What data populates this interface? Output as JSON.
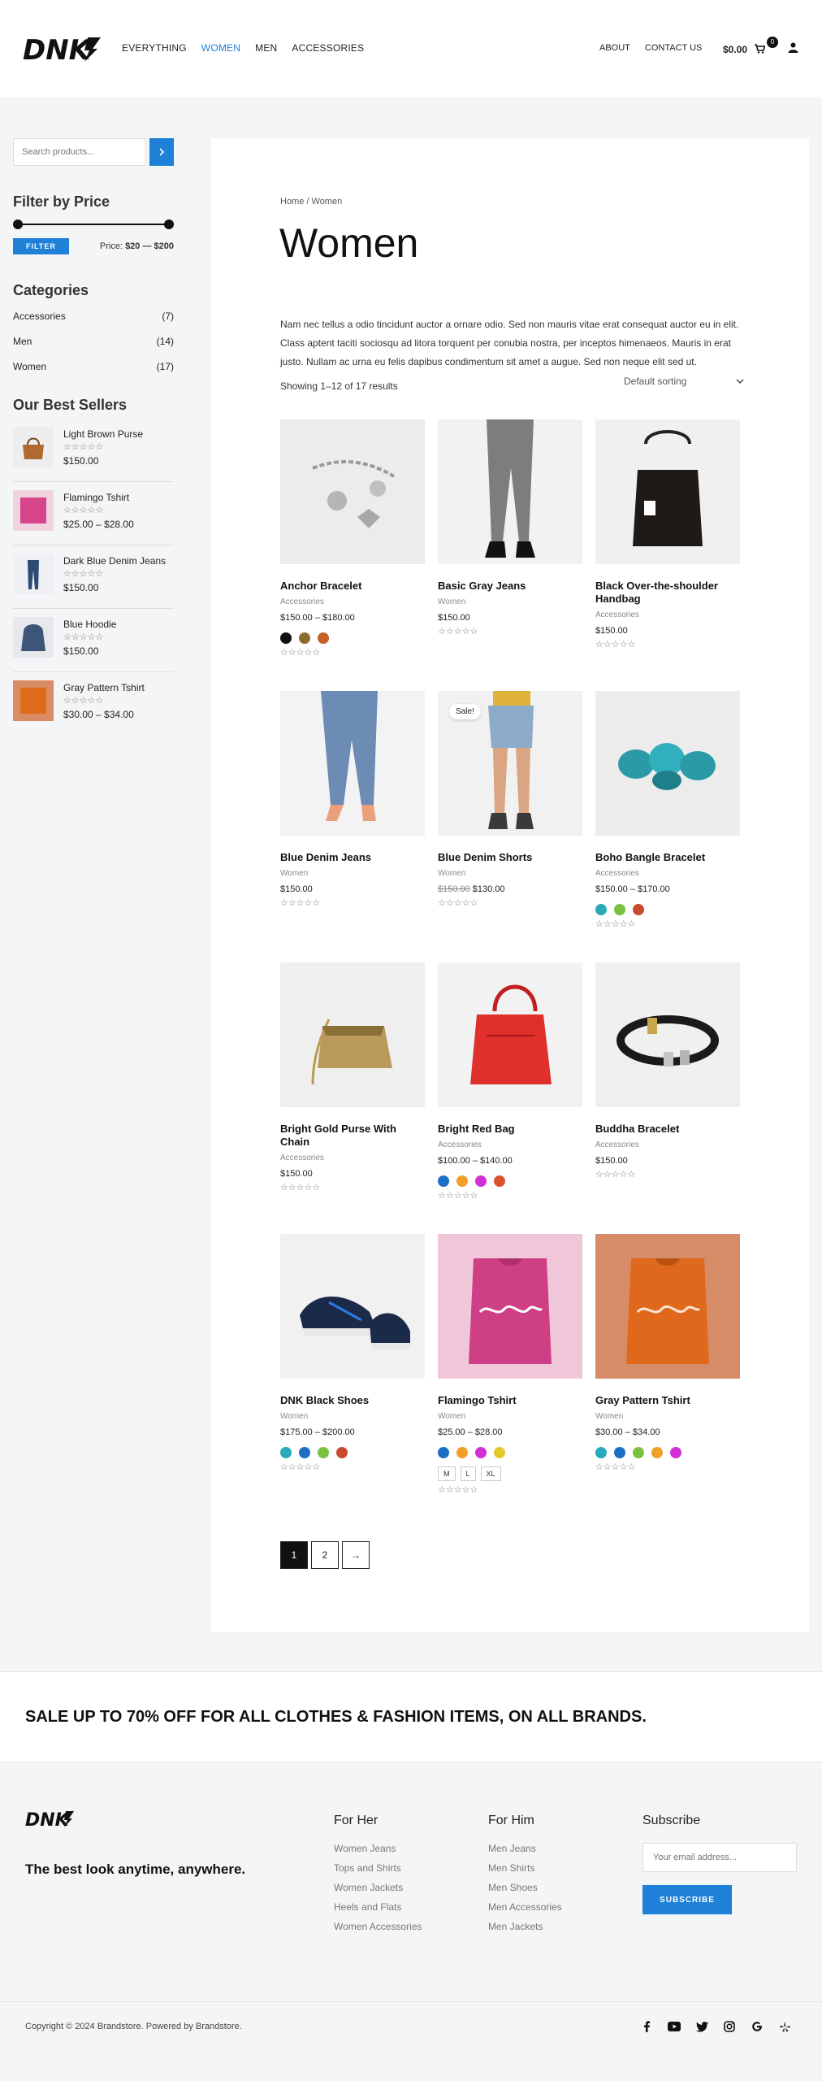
{
  "header": {
    "logo": "DNK",
    "nav": [
      "EVERYTHING",
      "WOMEN",
      "MEN",
      "ACCESSORIES"
    ],
    "nav_active": "WOMEN",
    "nav_right": [
      "ABOUT",
      "CONTACT US"
    ],
    "cart_total": "$0.00",
    "cart_count": "0"
  },
  "sidebar": {
    "search_placeholder": "Search products...",
    "filter_title": "Filter by Price",
    "filter_button": "FILTER",
    "price_prefix": "Price:",
    "price_range": "$20 — $200",
    "categories_title": "Categories",
    "categories": [
      {
        "name": "Accessories",
        "count": "(7)"
      },
      {
        "name": "Men",
        "count": "(14)"
      },
      {
        "name": "Women",
        "count": "(17)"
      }
    ],
    "best_title": "Our Best Sellers",
    "best_sellers": [
      {
        "name": "Light Brown Purse",
        "price": "$150.00"
      },
      {
        "name": "Flamingo Tshirt",
        "price": "$25.00 – $28.00"
      },
      {
        "name": "Dark Blue Denim Jeans",
        "price": "$150.00"
      },
      {
        "name": "Blue Hoodie",
        "price": "$150.00"
      },
      {
        "name": "Gray Pattern Tshirt",
        "price": "$30.00 – $34.00"
      }
    ]
  },
  "main": {
    "breadcrumb": "Home / Women",
    "title": "Women",
    "description": "Nam nec tellus a odio tincidunt auctor a ornare odio. Sed non mauris vitae erat consequat auctor eu in elit. Class aptent taciti sociosqu ad litora torquent per conubia nostra, per inceptos himenaeos. Mauris in erat justo. Nullam ac urna eu felis dapibus condimentum sit amet a augue. Sed non neque elit sed ut.",
    "results": "Showing 1–12 of 17 results",
    "sorting": "Default sorting",
    "stars": "☆☆☆☆☆",
    "products": [
      {
        "name": "Anchor Bracelet",
        "category": "Accessories",
        "price": "$150.00 – $180.00",
        "swatches": [
          "#111111",
          "#8a6d2e",
          "#c4602a"
        ]
      },
      {
        "name": "Basic Gray Jeans",
        "category": "Women",
        "price": "$150.00"
      },
      {
        "name": "Black Over-the-shoulder Handbag",
        "category": "Accessories",
        "price": "$150.00"
      },
      {
        "name": "Blue Denim Jeans",
        "category": "Women",
        "price": "$150.00"
      },
      {
        "name": "Blue Denim Shorts",
        "category": "Women",
        "old_price": "$150.00",
        "price": "$130.00",
        "badge": "Sale!"
      },
      {
        "name": "Boho Bangle Bracelet",
        "category": "Accessories",
        "price": "$150.00 – $170.00",
        "swatches": [
          "#2aa9b8",
          "#7ac142",
          "#c84b31"
        ]
      },
      {
        "name": "Bright Gold Purse With Chain",
        "category": "Accessories",
        "price": "$150.00"
      },
      {
        "name": "Bright Red Bag",
        "category": "Accessories",
        "price": "$100.00 – $140.00",
        "swatches": [
          "#1e6fc4",
          "#f0a02a",
          "#d42fd4",
          "#d9532e"
        ]
      },
      {
        "name": "Buddha Bracelet",
        "category": "Accessories",
        "price": "$150.00"
      },
      {
        "name": "DNK Black Shoes",
        "category": "Women",
        "price": "$175.00 – $200.00",
        "swatches": [
          "#2aa9b8",
          "#1e6fc4",
          "#7ac142",
          "#c84b31"
        ]
      },
      {
        "name": "Flamingo Tshirt",
        "category": "Women",
        "price": "$25.00 – $28.00",
        "swatches": [
          "#1e6fc4",
          "#f0a02a",
          "#d42fd4",
          "#e6c92a"
        ],
        "sizes": [
          "M",
          "L",
          "XL"
        ]
      },
      {
        "name": "Gray Pattern Tshirt",
        "category": "Women",
        "price": "$30.00 – $34.00",
        "swatches": [
          "#2aa9b8",
          "#1e6fc4",
          "#7ac142",
          "#f0a02a",
          "#d42fd4"
        ]
      }
    ],
    "pagination": [
      "1",
      "2",
      "→"
    ]
  },
  "promo": {
    "text": "SALE UP TO 70% OFF FOR ALL CLOTHES & FASHION ITEMS, ON ALL BRANDS."
  },
  "footer": {
    "logo": "DNK",
    "tagline": "The best look anytime, anywhere.",
    "for_her_title": "For Her",
    "for_her": [
      "Women Jeans",
      "Tops and Shirts",
      "Women Jackets",
      "Heels and Flats",
      "Women Accessories"
    ],
    "for_him_title": "For Him",
    "for_him": [
      "Men Jeans",
      "Men Shirts",
      "Men Shoes",
      "Men Accessories",
      "Men Jackets"
    ],
    "subscribe_title": "Subscribe",
    "email_placeholder": "Your email address...",
    "subscribe_button": "SUBSCRIBE",
    "copyright": "Copyright © 2024 Brandstore. Powered by Brandstore.",
    "socials": [
      "facebook-icon",
      "youtube-icon",
      "twitter-icon",
      "instagram-icon",
      "google-icon",
      "yelp-icon"
    ]
  },
  "colors": {
    "accent": "#1e80d6",
    "page_bg": "#f4f5f7"
  }
}
